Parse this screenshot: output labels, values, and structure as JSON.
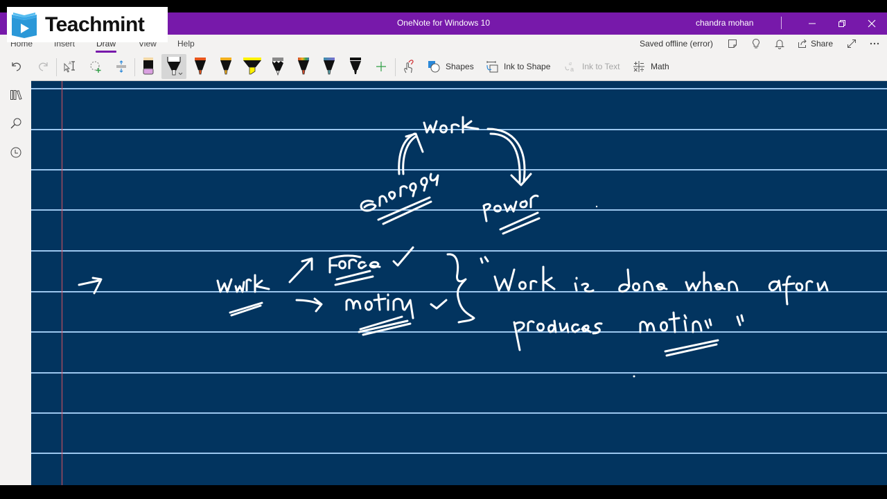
{
  "window": {
    "app_title": "OneNote for Windows 10",
    "user_name": "chandra mohan",
    "minimize_icon": "minimize-icon",
    "restore_icon": "restore-icon",
    "close_icon": "close-icon"
  },
  "watermark": {
    "brand": "Teachmint",
    "logo_icon": "book-play-icon"
  },
  "ribbon": {
    "tabs": [
      {
        "label": "Home"
      },
      {
        "label": "Insert"
      },
      {
        "label": "Draw",
        "active": true
      },
      {
        "label": "View"
      },
      {
        "label": "Help"
      }
    ],
    "status": "Saved offline (error)",
    "share_label": "Share",
    "right_icons": [
      "sticky-notes-icon",
      "lightbulb-icon",
      "bell-icon",
      "share-icon",
      "expand-icon",
      "more-icon"
    ]
  },
  "toolbar": {
    "items": [
      {
        "name": "undo",
        "icon": "undo-icon"
      },
      {
        "name": "redo",
        "icon": "redo-icon"
      },
      {
        "name": "type-select",
        "icon": "lasso-text-icon"
      },
      {
        "name": "lasso-select",
        "icon": "lasso-add-icon"
      },
      {
        "name": "add-space",
        "icon": "add-space-icon"
      },
      {
        "name": "eraser",
        "icon": "eraser-icon"
      },
      {
        "name": "black-pen",
        "icon": "pen-icon",
        "selected": true,
        "color": "#000000"
      },
      {
        "name": "orange-pen",
        "icon": "pen-icon",
        "color": "#e8561c"
      },
      {
        "name": "yellow-pen",
        "icon": "pen-icon",
        "color": "#f2b01e"
      },
      {
        "name": "highlighter",
        "icon": "highlighter-icon",
        "color": "#fff100"
      },
      {
        "name": "pencil",
        "icon": "pencil-icon",
        "color": "#8a8a8a"
      },
      {
        "name": "galaxy-pen",
        "icon": "pen-icon",
        "color": "#d04a2a"
      },
      {
        "name": "ocean-pen",
        "icon": "pen-icon",
        "color": "#3f6fb0"
      },
      {
        "name": "black-pen-2",
        "icon": "pen-icon",
        "color": "#000000"
      },
      {
        "name": "add-pen",
        "icon": "plus-icon"
      },
      {
        "name": "touch-drawing",
        "icon": "touch-draw-icon"
      }
    ],
    "shapes_label": "Shapes",
    "ink_to_shape_label": "Ink to Shape",
    "ink_to_text_label": "Ink to Text",
    "math_label": "Math"
  },
  "leftnav": {
    "items": [
      {
        "name": "notebooks",
        "icon": "notebooks-icon"
      },
      {
        "name": "search",
        "icon": "search-icon"
      },
      {
        "name": "recent",
        "icon": "clock-icon"
      }
    ]
  },
  "page": {
    "background_color": "#02345f",
    "rule_color": "#9cc7ef",
    "margin_color": "#d9515d",
    "ink_color": "#ffffff",
    "handwritten_notes": [
      "work",
      "energy",
      "power",
      "work → Force ✓",
      "→ motion ✓",
      "\"Work is done when a force produces motion\""
    ]
  }
}
